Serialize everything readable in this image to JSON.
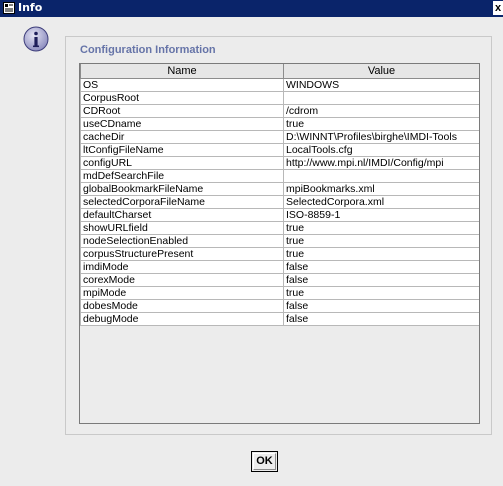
{
  "window": {
    "title": "Info",
    "close_glyph": "x",
    "title_icon": "info-window-icon",
    "message_icon": "info-icon",
    "colors": {
      "titlebar": "#0a246a",
      "panel_title": "#6674a8",
      "background": "#ececec"
    }
  },
  "panel": {
    "title": "Configuration Information"
  },
  "table": {
    "columns": [
      "Name",
      "Value"
    ],
    "rows": [
      {
        "name": "OS",
        "value": "WINDOWS"
      },
      {
        "name": "CorpusRoot",
        "value": ""
      },
      {
        "name": "CDRoot",
        "value": "/cdrom"
      },
      {
        "name": "useCDname",
        "value": "true"
      },
      {
        "name": "cacheDir",
        "value": "D:\\WINNT\\Profiles\\birghe\\IMDI-Tools"
      },
      {
        "name": "ltConfigFileName",
        "value": "LocalTools.cfg"
      },
      {
        "name": "configURL",
        "value": "http://www.mpi.nl/IMDI/Config/mpi"
      },
      {
        "name": "mdDefSearchFile",
        "value": ""
      },
      {
        "name": "globalBookmarkFileName",
        "value": "mpiBookmarks.xml"
      },
      {
        "name": "selectedCorporaFileName",
        "value": "SelectedCorpora.xml"
      },
      {
        "name": "defaultCharset",
        "value": "ISO-8859-1"
      },
      {
        "name": "showURLfield",
        "value": "true"
      },
      {
        "name": "nodeSelectionEnabled",
        "value": "true"
      },
      {
        "name": "corpusStructurePresent",
        "value": "true"
      },
      {
        "name": "imdiMode",
        "value": "false"
      },
      {
        "name": "corexMode",
        "value": "false"
      },
      {
        "name": "mpiMode",
        "value": "true"
      },
      {
        "name": "dobesMode",
        "value": "false"
      },
      {
        "name": "debugMode",
        "value": "false"
      }
    ]
  },
  "buttons": {
    "ok_label": "OK"
  }
}
